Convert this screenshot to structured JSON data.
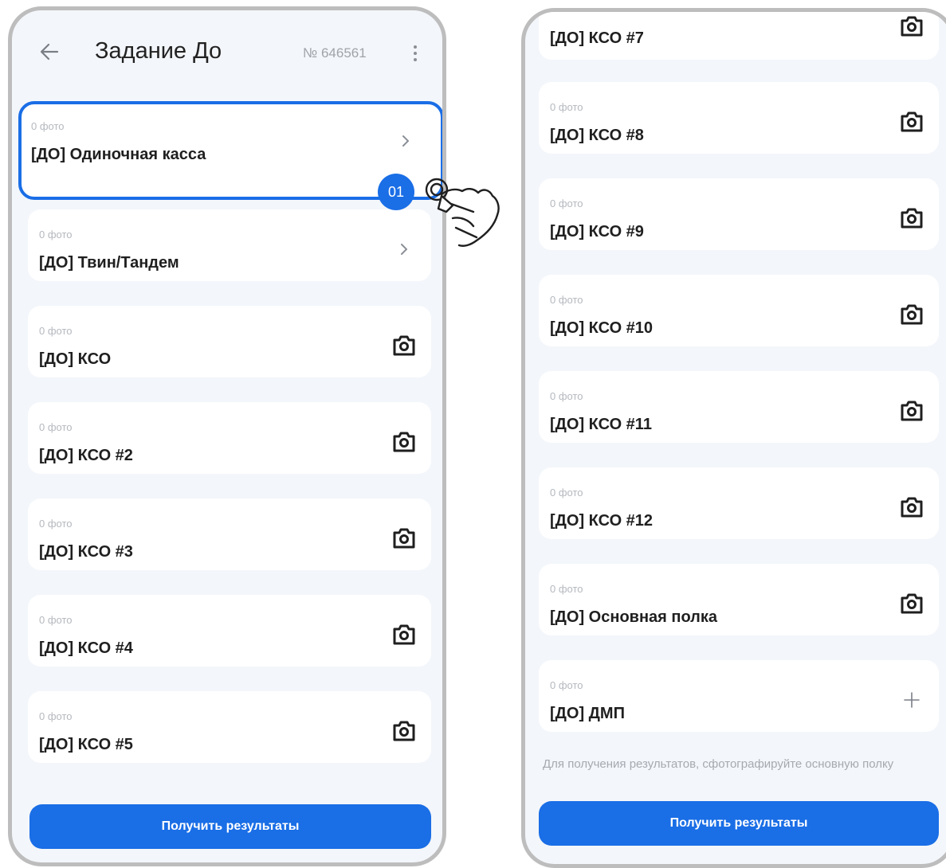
{
  "left_screen": {
    "header": {
      "back_icon": "arrow-left-icon",
      "title": "Задание До",
      "number": "№ 646561",
      "menu_icon": "more-vertical-icon"
    },
    "items": [
      {
        "photos": "0 фото",
        "title": "[ДО] Одиночная касса",
        "trailing": "chevron-right-icon",
        "selected": true
      },
      {
        "photos": "0 фото",
        "title": "[ДО] Твин/Тандем",
        "trailing": "chevron-right-icon"
      },
      {
        "photos": "0 фото",
        "title": "[ДО] КСО",
        "trailing": "camera-icon"
      },
      {
        "photos": "0 фото",
        "title": "[ДО] КСО #2",
        "trailing": "camera-icon"
      },
      {
        "photos": "0 фото",
        "title": "[ДО] КСО #3",
        "trailing": "camera-icon"
      },
      {
        "photos": "0 фото",
        "title": "[ДО] КСО #4",
        "trailing": "camera-icon"
      },
      {
        "photos": "0 фото",
        "title": "[ДО] КСО #5",
        "trailing": "camera-icon"
      }
    ],
    "button_label": "Получить результаты",
    "step_badge": "01"
  },
  "right_screen": {
    "items": [
      {
        "photos": "",
        "title": "[ДО] КСО #7",
        "trailing": "camera-icon"
      },
      {
        "photos": "0 фото",
        "title": "[ДО] КСО #8",
        "trailing": "camera-icon"
      },
      {
        "photos": "0 фото",
        "title": "[ДО] КСО #9",
        "trailing": "camera-icon"
      },
      {
        "photos": "0 фото",
        "title": "[ДО] КСО #10",
        "trailing": "camera-icon"
      },
      {
        "photos": "0 фото",
        "title": "[ДО] КСО #11",
        "trailing": "camera-icon"
      },
      {
        "photos": "0 фото",
        "title": "[ДО] КСО #12",
        "trailing": "camera-icon"
      },
      {
        "photos": "0 фото",
        "title": "[ДО] Основная полка",
        "trailing": "camera-icon"
      },
      {
        "photos": "0 фото",
        "title": "[ДО] ДМП",
        "trailing": "plus-icon"
      }
    ],
    "hint": "Для получения результатов, сфотографируйте основную полку",
    "button_label": "Получить результаты"
  },
  "colors": {
    "accent": "#1a6ee6",
    "screen_bg": "#f3f6fa",
    "card_bg": "#ffffff",
    "frame": "#bdbdbd"
  }
}
